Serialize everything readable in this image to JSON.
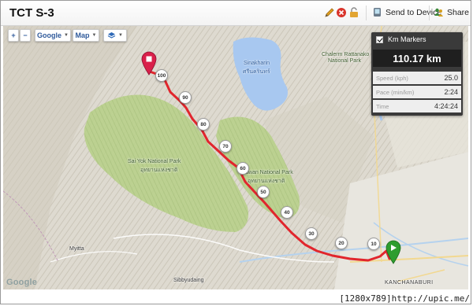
{
  "header": {
    "title": "TCT S-3",
    "send_label": "Send to Device",
    "share_label": "Share",
    "edit_icon": "pencil-icon",
    "delete_icon": "delete-icon",
    "lock_icon": "lock-icon"
  },
  "map_controls": {
    "zoom_in": "+",
    "zoom_out": "−",
    "provider": "Google",
    "type": "Map",
    "layers_icon": "layers-icon"
  },
  "panel": {
    "km_markers_label": "Km Markers",
    "km_markers_checked": true,
    "distance": "110.17 km",
    "stats": [
      {
        "label": "Speed (kph)",
        "value": "25.0"
      },
      {
        "label": "Pace (min/km)",
        "value": "2:24"
      },
      {
        "label": "Time",
        "value": "4:24:24"
      }
    ]
  },
  "map": {
    "labels": {
      "sinakharin": "Sinakharin",
      "sinakharin_thai": "ศรีนครินทร์",
      "chalerm_1": "Chalerm Rattanako",
      "chalerm_2": "National Park",
      "sai_yok_1": "Sai Yok National Park",
      "sai_yok_2": "อุทยานแห่งชาติ",
      "erawan_1": "Erawan National Park",
      "erawan_2": "อุทยานแห่งชาติ",
      "myitta": "Myitta",
      "sibbyudaing": "Sibbyudaing",
      "kanchanaburi": "KANCHANABURI",
      "google": "Google"
    },
    "km_markers": [
      "100",
      "90",
      "80",
      "70",
      "60",
      "50",
      "40",
      "30",
      "20",
      "10"
    ],
    "route_color": "#e1262d",
    "start_color": "#2e9d2e",
    "end_color": "#d9204a"
  },
  "footer": {
    "caption": "[1280x789]http://upic.me/"
  }
}
